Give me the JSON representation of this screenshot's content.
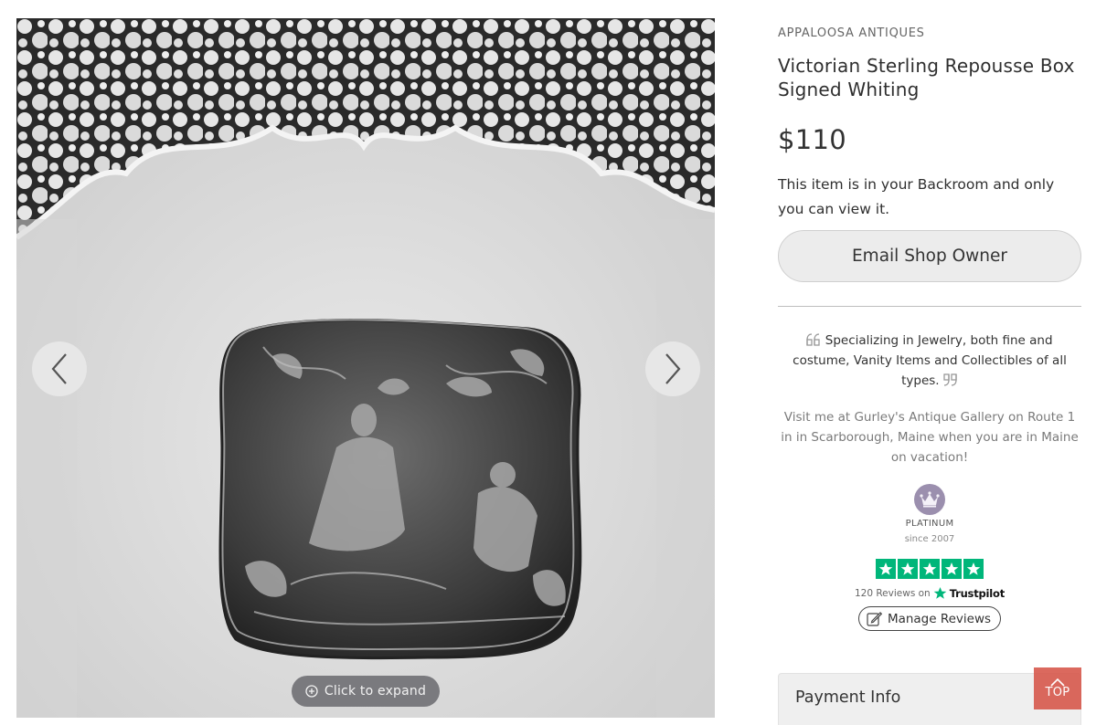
{
  "gallery": {
    "expand_label": "Click to expand"
  },
  "product": {
    "shop_name": "APPALOOSA ANTIQUES",
    "title": "Victorian Sterling Repousse Box Signed Whiting",
    "price": "$110",
    "note": "This item is in your Backroom and only you can view it.",
    "email_button": "Email Shop Owner"
  },
  "shop": {
    "specializing": "Specializing in Jewelry, both fine and costume, Vanity Items and Collectibles of all types.",
    "visit": "Visit me at Gurley's Antique Gallery on Route 1 in in Scarborough, Maine when you are in Maine on vacation!",
    "tier": "PLATINUM",
    "since": "since 2007",
    "reviews_count": "120 Reviews on",
    "trustpilot": "Trustpilot",
    "manage_reviews": "Manage Reviews",
    "star_rating": 5
  },
  "payment": {
    "label": "Payment Info"
  },
  "top_button": "TOP",
  "colors": {
    "trustpilot_green": "#00b67a",
    "top_button": "#d65448",
    "badge": "#9b8fae"
  }
}
